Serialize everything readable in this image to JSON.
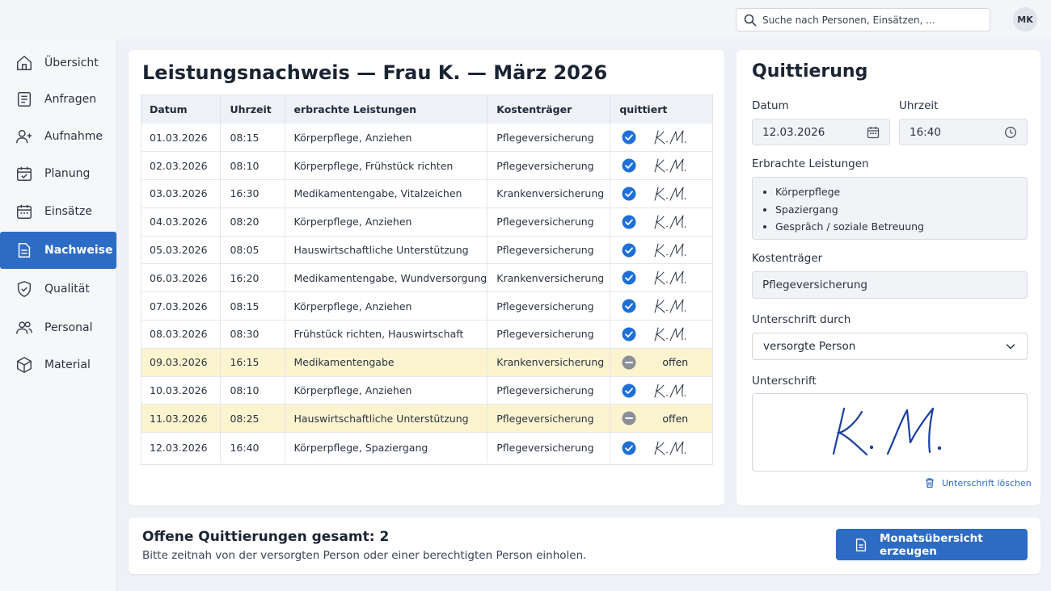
{
  "topbar": {
    "search_placeholder": "Suche nach Personen, Einsätzen, ...",
    "avatar_initials": "MK"
  },
  "sidebar": {
    "items": [
      {
        "label": "Übersicht",
        "icon": "home-icon"
      },
      {
        "label": "Anfragen",
        "icon": "document-list-icon"
      },
      {
        "label": "Aufnahme",
        "icon": "add-person-icon"
      },
      {
        "label": "Planung",
        "icon": "calendar-check-icon"
      },
      {
        "label": "Einsätze",
        "icon": "calendar-icon"
      },
      {
        "label": "Nachweise",
        "icon": "document-icon",
        "active": true
      },
      {
        "label": "Qualität",
        "icon": "shield-check-icon"
      },
      {
        "label": "Personal",
        "icon": "people-icon"
      },
      {
        "label": "Material",
        "icon": "box-icon"
      }
    ]
  },
  "main": {
    "title": "Leistungsnachweis — Frau K. — März 2026",
    "columns": [
      "Datum",
      "Uhrzeit",
      "erbrachte Leistungen",
      "Kostenträger",
      "quittiert"
    ],
    "rows": [
      {
        "datum": "01.03.2026",
        "uhrzeit": "08:15",
        "leistungen": "Körperpflege, Anziehen",
        "kostentraeger": "Pflegeversicherung",
        "quittiert": true
      },
      {
        "datum": "02.03.2026",
        "uhrzeit": "08:10",
        "leistungen": "Körperpflege, Frühstück richten",
        "kostentraeger": "Pflegeversicherung",
        "quittiert": true
      },
      {
        "datum": "03.03.2026",
        "uhrzeit": "16:30",
        "leistungen": "Medikamentengabe, Vitalzeichen",
        "kostentraeger": "Krankenversicherung",
        "quittiert": true
      },
      {
        "datum": "04.03.2026",
        "uhrzeit": "08:20",
        "leistungen": "Körperpflege, Anziehen",
        "kostentraeger": "Pflegeversicherung",
        "quittiert": true
      },
      {
        "datum": "05.03.2026",
        "uhrzeit": "08:05",
        "leistungen": "Hauswirtschaftliche Unterstützung",
        "kostentraeger": "Pflegeversicherung",
        "quittiert": true
      },
      {
        "datum": "06.03.2026",
        "uhrzeit": "16:20",
        "leistungen": "Medikamentengabe, Wundversorgung",
        "kostentraeger": "Krankenversicherung",
        "quittiert": true
      },
      {
        "datum": "07.03.2026",
        "uhrzeit": "08:15",
        "leistungen": "Körperpflege, Anziehen",
        "kostentraeger": "Pflegeversicherung",
        "quittiert": true
      },
      {
        "datum": "08.03.2026",
        "uhrzeit": "08:30",
        "leistungen": "Frühstück richten, Hauswirtschaft",
        "kostentraeger": "Pflegeversicherung",
        "quittiert": true
      },
      {
        "datum": "09.03.2026",
        "uhrzeit": "16:15",
        "leistungen": "Medikamentengabe",
        "kostentraeger": "Krankenversicherung",
        "quittiert": false,
        "status_text": "offen"
      },
      {
        "datum": "10.03.2026",
        "uhrzeit": "08:10",
        "leistungen": "Körperpflege, Anziehen",
        "kostentraeger": "Pflegeversicherung",
        "quittiert": true
      },
      {
        "datum": "11.03.2026",
        "uhrzeit": "08:25",
        "leistungen": "Hauswirtschaftliche Unterstützung",
        "kostentraeger": "Pflegeversicherung",
        "quittiert": false,
        "status_text": "offen"
      },
      {
        "datum": "12.03.2026",
        "uhrzeit": "16:40",
        "leistungen": "Körperpflege, Spaziergang",
        "kostentraeger": "Pflegeversicherung",
        "quittiert": true
      }
    ],
    "signature_initials": "K. M."
  },
  "quittierung": {
    "title": "Quittierung",
    "datum_label": "Datum",
    "datum_value": "12.03.2026",
    "uhrzeit_label": "Uhrzeit",
    "uhrzeit_value": "16:40",
    "leistungen_label": "Erbrachte Leistungen",
    "leistungen": [
      "Körperpflege",
      "Spaziergang",
      "Gespräch / soziale Betreuung"
    ],
    "kostentraeger_label": "Kostenträger",
    "kostentraeger_value": "Pflegeversicherung",
    "unterschrift_durch_label": "Unterschrift durch",
    "unterschrift_durch_value": "versorgte Person",
    "unterschrift_label": "Unterschrift",
    "clear_signature_label": "Unterschrift löschen"
  },
  "footer": {
    "title": "Offene Quittierungen gesamt: 2",
    "text": "Bitte zeitnah von der versorgten Person oder einer berechtigten Person einholen.",
    "button_label": "Monatsübersicht erzeugen"
  },
  "colors": {
    "accent": "#2d6cc4",
    "open_row": "#fcf4cf",
    "check": "#1f6fd6",
    "pending": "#8a8f98"
  }
}
